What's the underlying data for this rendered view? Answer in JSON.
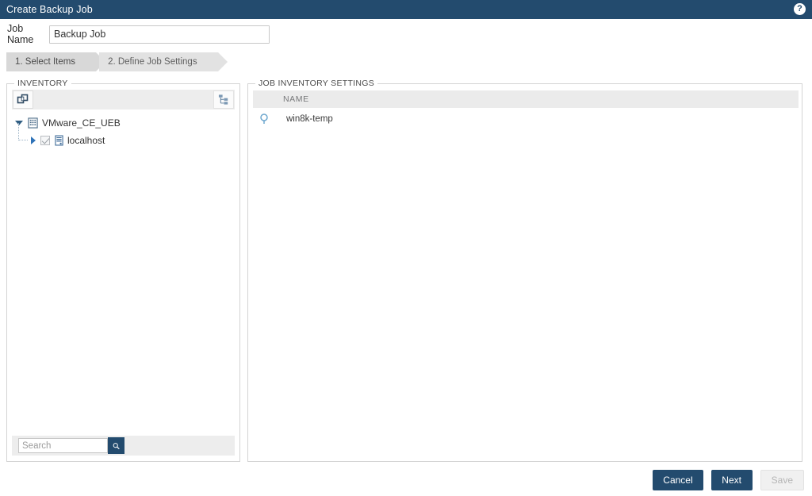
{
  "window": {
    "title": "Create Backup Job",
    "help_icon": "help-circle-icon",
    "help_label": "?"
  },
  "job_name": {
    "label": "Job Name",
    "value": "Backup Job",
    "placeholder": ""
  },
  "wizard": {
    "steps": [
      {
        "label": "1. Select Items",
        "active": true
      },
      {
        "label": "2. Define Job Settings",
        "active": false
      }
    ]
  },
  "inventory": {
    "legend": "INVENTORY",
    "toolbar": {
      "left_icon": "linked-objects-icon",
      "right_icon": "tree-view-icon"
    },
    "tree": [
      {
        "label": "VMware_CE_UEB",
        "icon": "datacenter-building-icon",
        "expander": "triangle-down",
        "expanded": true,
        "checkbox": false
      },
      {
        "label": "localhost",
        "icon": "server-tower-icon",
        "expander": "triangle-right",
        "expanded": false,
        "checkbox": true,
        "checked": true
      }
    ],
    "search": {
      "placeholder": "Search",
      "value": "",
      "button_icon": "search-magnifier-icon"
    }
  },
  "job_inventory_settings": {
    "legend": "JOB INVENTORY SETTINGS",
    "columns": [
      "NAME"
    ],
    "rows": [
      {
        "icon": "vm-marker-icon",
        "name": "win8k-temp"
      }
    ]
  },
  "footer": {
    "cancel_label": "Cancel",
    "next_label": "Next",
    "save_label": "Save",
    "save_disabled": true
  },
  "colors": {
    "navy": "#234b6e",
    "panel_border": "#d4d4d4",
    "toolbar_gray": "#ededed",
    "table_header_gray": "#ebebeb",
    "step_active": "#d8d8d8",
    "step_inactive": "#e2e2e2",
    "icon_blue": "#2f73b8"
  }
}
